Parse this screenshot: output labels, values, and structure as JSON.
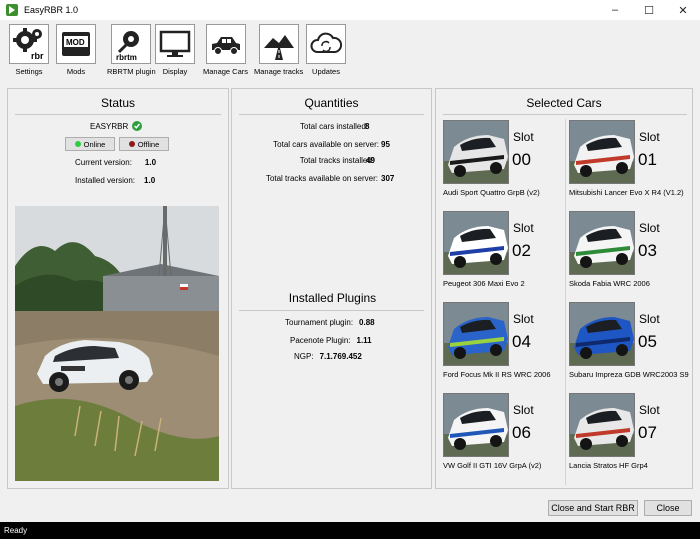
{
  "window": {
    "title": "EasyRBR 1.0",
    "minimize": "–",
    "maximize": "☐",
    "close": "✕"
  },
  "toolbar": [
    {
      "label": "Settings",
      "icon": "gears-rbr-icon"
    },
    {
      "label": "Mods",
      "icon": "mod-box-icon"
    },
    {
      "label": "RBRTM plugin",
      "icon": "rbrtm-icon"
    },
    {
      "label": "Display",
      "icon": "monitor-icon"
    },
    {
      "label": "Manage Cars",
      "icon": "car-icon"
    },
    {
      "label": "Manage tracks",
      "icon": "road-icon"
    },
    {
      "label": "Updates",
      "icon": "cloud-sync-icon"
    }
  ],
  "status": {
    "title": "Status",
    "app_name": "EASYRBR",
    "online_label": "Online",
    "offline_label": "Offline",
    "current_version_label": "Current version:",
    "current_version": "1.0",
    "installed_version_label": "Installed version:",
    "installed_version": "1.0"
  },
  "quantities": {
    "title": "Quantities",
    "rows": [
      {
        "label": "Total cars installed:",
        "value": "8"
      },
      {
        "label": "Total cars available on server:",
        "value": "95"
      },
      {
        "label": "Total tracks installed:",
        "value": "49"
      },
      {
        "label": "Total tracks available on server:",
        "value": "307"
      }
    ]
  },
  "plugins": {
    "title": "Installed Plugins",
    "rows": [
      {
        "label": "Tournament plugin:",
        "value": "0.88"
      },
      {
        "label": "Pacenote Plugin:",
        "value": "1.11"
      },
      {
        "label": "NGP:",
        "value": "7.1.769.452"
      }
    ]
  },
  "selected": {
    "title": "Selected Cars",
    "slot_label": "Slot",
    "cars": [
      {
        "num": "00",
        "name": "Audi Sport Quattro GrpB (v2)",
        "body": "#e6e6e6",
        "stripe": "#1a1a1a"
      },
      {
        "num": "01",
        "name": "Mitsubishi Lancer Evo X R4 (V1.2)",
        "body": "#f2f2f2",
        "stripe": "#c0392b"
      },
      {
        "num": "02",
        "name": "Peugeot 306 Maxi Evo 2",
        "body": "#ffffff",
        "stripe": "#1f3fa8"
      },
      {
        "num": "03",
        "name": "Skoda Fabia WRC 2006",
        "body": "#f5f5f5",
        "stripe": "#2e8b3a"
      },
      {
        "num": "04",
        "name": "Ford Focus Mk II RS WRC 2006",
        "body": "#2a63c9",
        "stripe": "#9bd13c"
      },
      {
        "num": "05",
        "name": "Subaru Impreza GDB WRC2003 S9",
        "body": "#1e56c4",
        "stripe": "#0f2a6b"
      },
      {
        "num": "06",
        "name": "VW Golf II GTI 16V GrpA (v2)",
        "body": "#f5f5f5",
        "stripe": "#1f57b8"
      },
      {
        "num": "07",
        "name": "Lancia Stratos HF Grp4",
        "body": "#e8e8e8",
        "stripe": "#c0392b"
      }
    ]
  },
  "buttons": {
    "close_start": "Close and Start RBR",
    "close": "Close"
  },
  "statusbar": {
    "text": "Ready"
  },
  "colors": {
    "online_dot": "#2ecc40",
    "offline_dot": "#8b1a1a",
    "check_green": "#2e9e3e"
  }
}
